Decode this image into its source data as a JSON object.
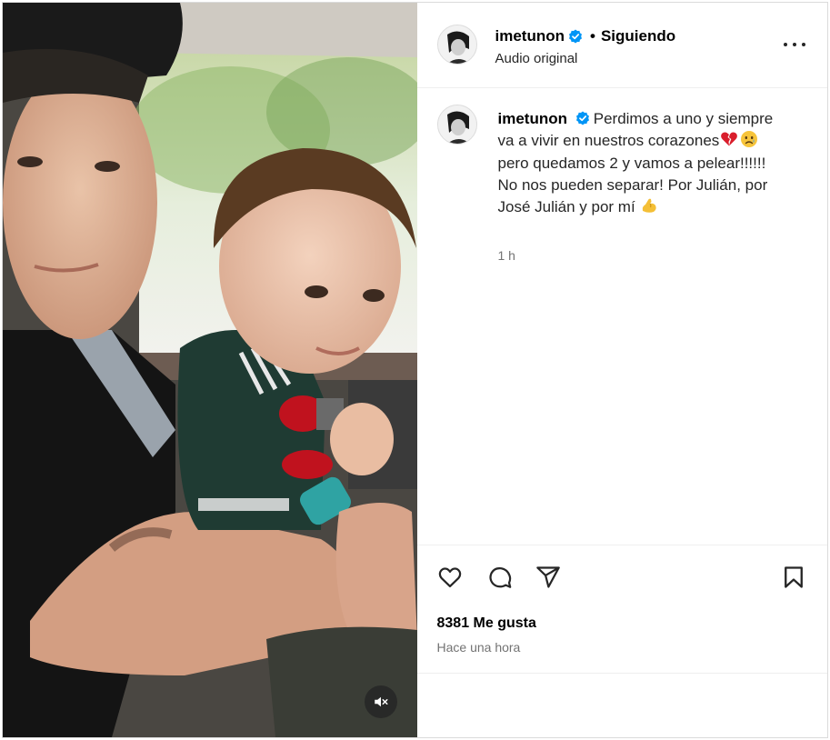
{
  "header": {
    "username": "imetunon",
    "separator": "•",
    "follow_status": "Siguiendo",
    "audio": "Audio original"
  },
  "caption": {
    "username": "imetunon",
    "text_part1": "Perdimos a uno y siempre va a vivir en nuestros corazones",
    "text_part2": " pero quedamos 2 y vamos a pelear!!!!!! No nos pueden separar! Por Julián, por José Julián y por mí ",
    "time": "1 h"
  },
  "engagement": {
    "likes": "8381 Me gusta",
    "posted": "Hace una hora"
  },
  "icons": {
    "verified": "verified-badge-icon",
    "more": "more-options-icon",
    "like": "heart-icon",
    "comment": "comment-bubble-icon",
    "share": "paper-plane-icon",
    "save": "bookmark-icon",
    "mute": "speaker-muted-icon"
  },
  "colors": {
    "verified_blue": "#0095f6",
    "muted_text": "#737373",
    "divider": "#efefef"
  }
}
